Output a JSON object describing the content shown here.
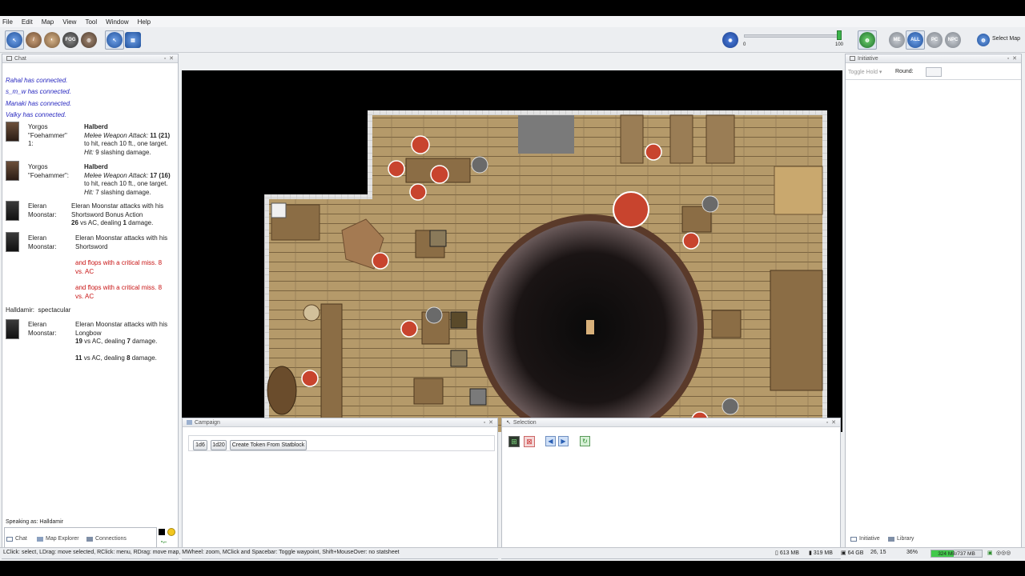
{
  "menu": [
    "File",
    "Edit",
    "Map",
    "View",
    "Tool",
    "Window",
    "Help"
  ],
  "toolbar": {
    "slider_min": "0",
    "slider_max": "100",
    "view_buttons": [
      "ME",
      "ALL",
      "PC",
      "NPC"
    ],
    "select_map_label": "Select Map",
    "fog_label": "FOG"
  },
  "chat": {
    "title": "Chat",
    "connections": [
      "Rahal has connected.",
      "s_m_w has connected.",
      "Manaki has connected.",
      "Valky has connected."
    ],
    "entries": [
      {
        "speaker": "Yorgos \"Foehammer\" 1:",
        "weapon": "Halberd",
        "attack_label": "Melee Weapon Attack:",
        "attack_value": "11",
        "attack_paren": "(21)",
        "reach_text": "to hit, reach 10 ft., one target.",
        "hit_label": "Hit:",
        "hit_text": "9 slashing damage."
      },
      {
        "speaker": "Yorgos \"Foehammer\":",
        "weapon": "Halberd",
        "attack_label": "Melee Weapon Attack:",
        "attack_value": "17",
        "attack_paren": "(16)",
        "reach_text": "to hit, reach 10 ft., one target.",
        "hit_label": "Hit:",
        "hit_text": "7 slashing damage."
      }
    ],
    "eleran1": {
      "speaker": "Eleran Moonstar:",
      "line1": "Eleran Moonstar attacks with his Shortsword Bonus Action",
      "roll": "26",
      "line2_a": " vs AC, dealing ",
      "dmg": "1",
      "line2_b": " damage."
    },
    "eleran2": {
      "speaker": "Eleran Moonstar:",
      "line1": "Eleran Moonstar attacks with his Shortsword",
      "miss1": "and flops with a critical miss. 8 vs. AC",
      "miss2": "and flops with a critical miss. 8 vs. AC"
    },
    "halldamir": {
      "speaker": "Halldamir:",
      "text": "spectacular"
    },
    "eleran3": {
      "speaker": "Eleran Moonstar:",
      "line1": "Eleran Moonstar attacks with his Longbow",
      "roll1": "19",
      "text1_a": " vs AC, dealing ",
      "dmg1": "7",
      "text1_b": " damage.",
      "roll2": "11",
      "text2_a": " vs AC, dealing ",
      "dmg2": "8",
      "text2_b": " damage."
    },
    "speaking_as": "Speaking as: Halldamir"
  },
  "bottom_tabs": [
    "Chat",
    "Map Explorer",
    "Connections"
  ],
  "campaign": {
    "title": "Campaign",
    "buttons": [
      "1d6",
      "1d20",
      "Create Token From Statblock"
    ]
  },
  "selection": {
    "title": "Selection"
  },
  "initiative": {
    "title": "Initiative",
    "toggle_hold": "Toggle Hold",
    "round_label": "Round:",
    "round_value": ""
  },
  "right_tabs": [
    "Initiative",
    "Library"
  ],
  "status": {
    "hint": "LClick: select, LDrag: move selected, RClick: menu, RDrag: move map, MWheel: zoom, MClick and Spacebar: Toggle waypoint, Shift+MouseOver: no statsheet",
    "mem1": "613 MB",
    "mem2": "319 MB",
    "disk": "64 GB",
    "coords": "26, 15",
    "zoom": "36%",
    "heap": "324 MB/737 MB"
  },
  "colors": {
    "accent": "#2a5fb4",
    "system_text": "#2a2ac0",
    "miss_text": "#c81414",
    "floor": "#b59a6a"
  }
}
